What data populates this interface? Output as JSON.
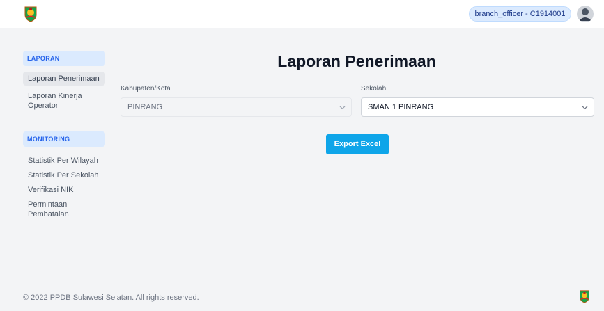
{
  "header": {
    "user_badge": "branch_officer - C1914001",
    "logo_icon": "sulsel-emblem-icon",
    "avatar_icon": "user-avatar-icon"
  },
  "sidebar": {
    "sections": [
      {
        "title": "LAPORAN",
        "items": [
          {
            "label": "Laporan Penerimaan",
            "active": true
          },
          {
            "label": "Laporan Kinerja Operator",
            "active": false
          }
        ]
      },
      {
        "title": "MONITORING",
        "items": [
          {
            "label": "Statistik Per Wilayah",
            "active": false
          },
          {
            "label": "Statistik Per Sekolah",
            "active": false
          },
          {
            "label": "Verifikasi NIK",
            "active": false
          },
          {
            "label": "Permintaan Pembatalan",
            "active": false
          }
        ]
      }
    ]
  },
  "main": {
    "title": "Laporan Penerimaan",
    "kabupaten": {
      "label": "Kabupaten/Kota",
      "value": "PINRANG",
      "disabled": true
    },
    "sekolah": {
      "label": "Sekolah",
      "value": "SMAN 1 PINRANG",
      "disabled": false
    },
    "export_label": "Export Excel"
  },
  "footer": {
    "copyright": "© 2022 PPDB Sulawesi Selatan. All rights reserved."
  },
  "colors": {
    "accent": "#0ea5e9",
    "section_bg": "#dbeafe",
    "section_text": "#2563eb",
    "page_bg": "#f3f4f6"
  }
}
